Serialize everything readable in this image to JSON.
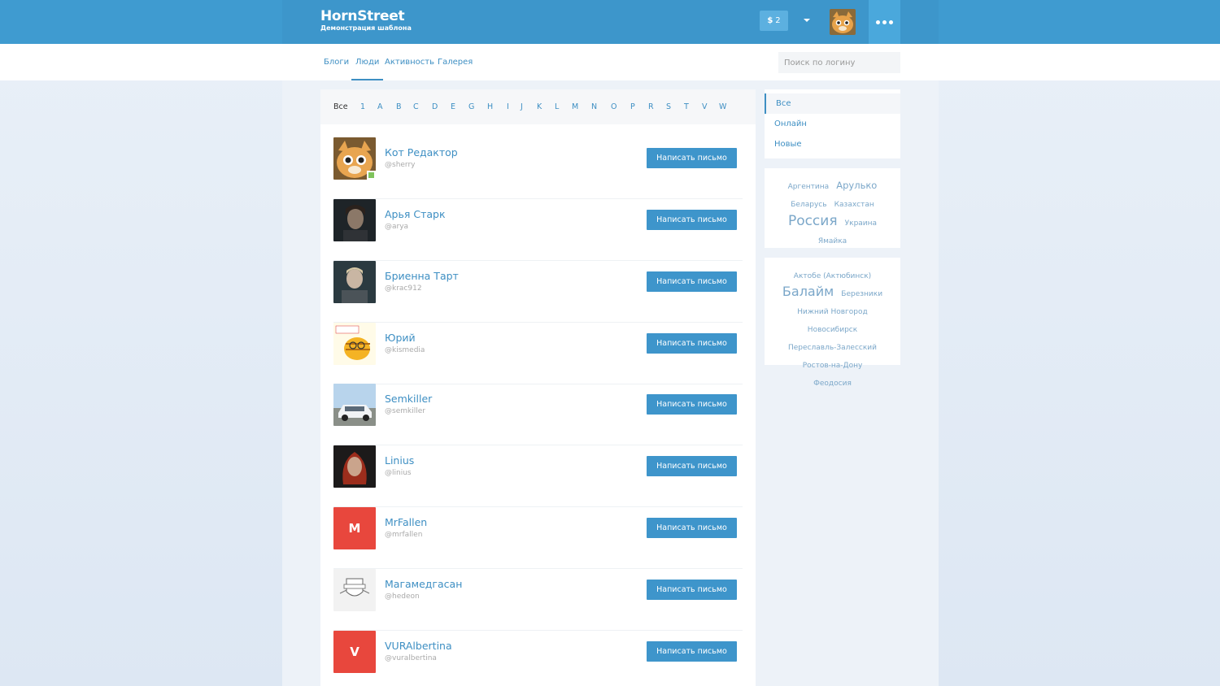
{
  "brand": {
    "title": "HornStreet",
    "subtitle": "Демонстрация шаблона"
  },
  "header": {
    "coins": "2",
    "coin_icon": "$"
  },
  "nav": {
    "tabs": [
      "Блоги",
      "Люди",
      "Активность",
      "Галерея"
    ],
    "active_tab": "Люди"
  },
  "search": {
    "placeholder": "Поиск по логину"
  },
  "alphabet": [
    "Все",
    "1",
    "A",
    "B",
    "C",
    "D",
    "E",
    "G",
    "H",
    "I",
    "J",
    "K",
    "L",
    "M",
    "N",
    "O",
    "P",
    "R",
    "S",
    "T",
    "V",
    "W"
  ],
  "users": [
    {
      "name": "Кот Редактор",
      "login": "@sherry",
      "button": "Написать письмо",
      "online": true
    },
    {
      "name": "Арья Старк",
      "login": "@arya",
      "button": "Написать письмо"
    },
    {
      "name": "Бриенна Тарт",
      "login": "@krac912",
      "button": "Написать письмо"
    },
    {
      "name": "Юрий",
      "login": "@kismedia",
      "button": "Написать письмо"
    },
    {
      "name": "Semkiller",
      "login": "@semkiller",
      "button": "Написать письмо"
    },
    {
      "name": "Linius",
      "login": "@linius",
      "button": "Написать письмо"
    },
    {
      "name": "MrFallen",
      "login": "@mrfallen",
      "button": "Написать письмо",
      "letter": "M"
    },
    {
      "name": "Магамедгасан",
      "login": "@hedeon",
      "button": "Написать письмо"
    },
    {
      "name": "VURAlbertina",
      "login": "@vuralbertina",
      "button": "Написать письмо",
      "letter": "V"
    }
  ],
  "sidebar": {
    "filters": [
      "Все",
      "Онлайн",
      "Новые"
    ]
  },
  "countries": [
    "Аргентина",
    "Арулько",
    "Беларусь",
    "Казахстан",
    "Россия",
    "Украина",
    "Ямайка"
  ],
  "cities": [
    "Актобе (Актюбинск)",
    "Балайм",
    "Березники",
    "Нижний Новгород",
    "Новосибирск",
    "Переславль-Залесский",
    "Ростов-на-Дону",
    "Феодосия"
  ],
  "colors": {
    "header": "#3d96cb",
    "accent": "#3e8fc3",
    "button": "#3e95cb",
    "letter_avatar": "#e8473d",
    "online": "#7fc35c"
  }
}
